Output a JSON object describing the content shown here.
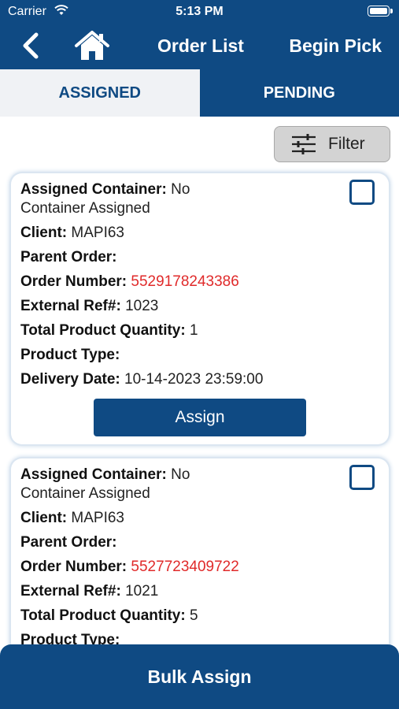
{
  "status": {
    "carrier": "Carrier",
    "time": "5:13 PM"
  },
  "header": {
    "title": "Order List",
    "begin_pick": "Begin Pick"
  },
  "tabs": [
    {
      "label": "ASSIGNED"
    },
    {
      "label": "PENDING"
    }
  ],
  "filter": {
    "label": "Filter"
  },
  "labels": {
    "assigned_container": "Assigned Container:",
    "client": "Client:",
    "parent_order": "Parent Order:",
    "order_number": "Order Number:",
    "external_ref": "External Ref#:",
    "total_qty": "Total Product Quantity:",
    "product_type": "Product Type:",
    "delivery_date": "Delivery Date:"
  },
  "orders": [
    {
      "container_line1": "No",
      "container_line2": "Container Assigned",
      "client": "MAPI63",
      "parent_order": "",
      "order_number": "5529178243386",
      "external_ref": "1023",
      "total_qty": "1",
      "product_type": "",
      "delivery_date": "10-14-2023 23:59:00",
      "assign_label": "Assign"
    },
    {
      "container_line1": "No",
      "container_line2": "Container Assigned",
      "client": "MAPI63",
      "parent_order": "",
      "order_number": "5527723409722",
      "external_ref": "1021",
      "total_qty": "5",
      "product_type": ""
    }
  ],
  "bulk_assign": "Bulk Assign",
  "colors": {
    "primary": "#0f4a83",
    "order_number": "#e02a2a",
    "tab_active_bg": "#f0f2f5"
  },
  "icons": [
    "back-chevron-icon",
    "home-icon",
    "filter-sliders-icon",
    "checkbox-icon"
  ]
}
